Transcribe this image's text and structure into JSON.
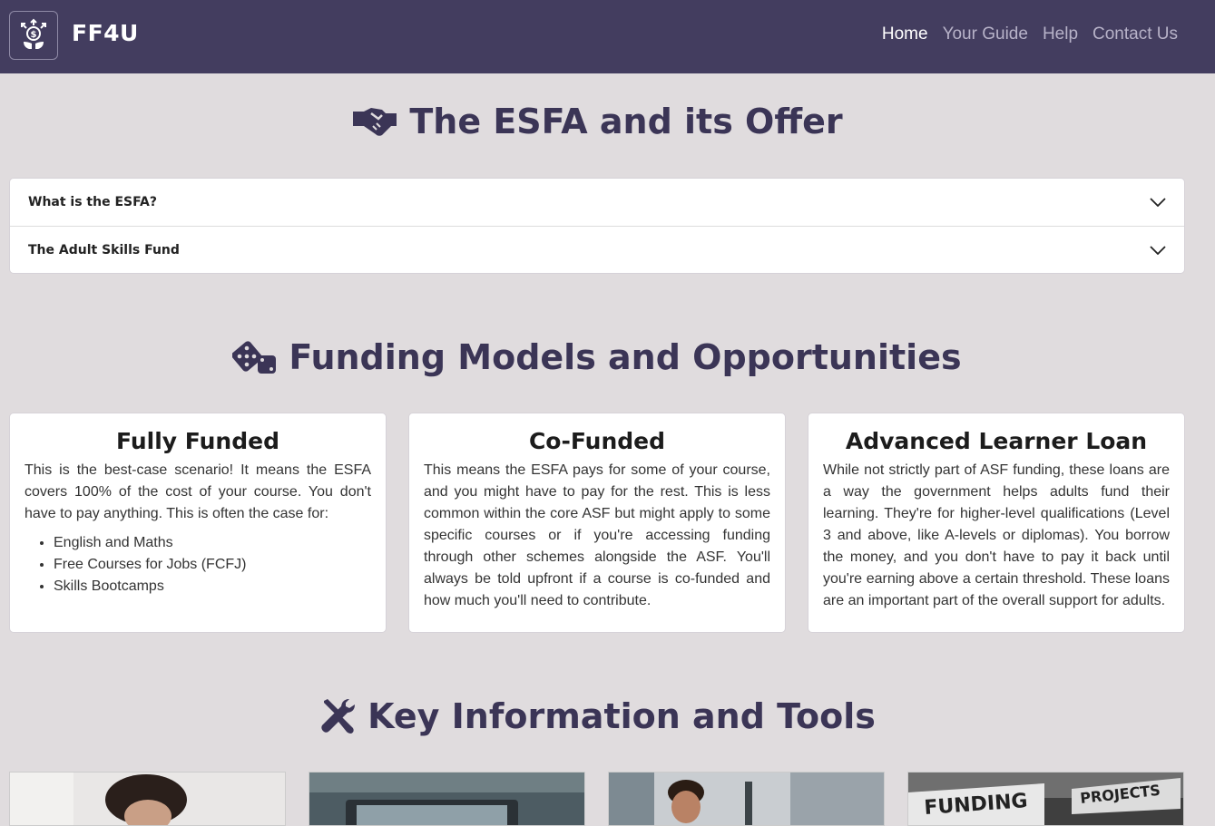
{
  "nav": {
    "brand": "FF4U",
    "links": [
      "Home",
      "Your Guide",
      "Help",
      "Contact Us"
    ]
  },
  "esfa": {
    "heading": "The ESFA and its Offer",
    "icon": "handshake-icon",
    "accordion": [
      "What is the ESFA?",
      "The Adult Skills Fund"
    ]
  },
  "funding": {
    "heading": "Funding Models and Opportunities",
    "icon": "dice-icon",
    "cards": [
      {
        "title": "Fully Funded",
        "text": "This is the best-case scenario! It means the ESFA covers 100% of the cost of your course. You don't have to pay anything. This is often the case for:",
        "list": [
          "English and Maths",
          "Free Courses for Jobs (FCFJ)",
          "Skills Bootcamps"
        ]
      },
      {
        "title": "Co-Funded",
        "text": "This means the ESFA pays for some of your course, and you might have to pay for the rest. This is less common within the core ASF but might apply to some specific courses or if you're accessing funding through other schemes alongside the ASF. You'll always be told upfront if a course is co-funded and how much you'll need to contribute."
      },
      {
        "title": "Advanced Learner Loan",
        "text": "While not strictly part of ASF funding, these loans are a way the government helps adults fund their learning. They're for higher-level qualifications (Level 3 and above, like A-levels or diplomas). You borrow the money, and you don't have to pay it back until you're earning above a certain threshold. These loans are an important part of the overall support for adults."
      }
    ]
  },
  "tools": {
    "heading": "Key Information and Tools",
    "icon": "tools-icon",
    "tile_text": [
      "FUNDING",
      "PROJECTS"
    ]
  },
  "colors": {
    "navbar": "#433d5f",
    "heading": "#3b3556",
    "page_bg": "#e0dcde"
  }
}
